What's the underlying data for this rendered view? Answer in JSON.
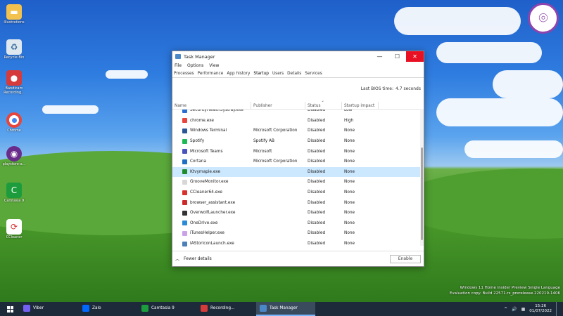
{
  "desktop": {
    "icons": [
      {
        "label": "Illustrations"
      },
      {
        "label": "Recycle Bin"
      },
      {
        "label": "Bandicam Recording..."
      },
      {
        "label": "Chrome"
      },
      {
        "label": "playstore-a..."
      },
      {
        "label": "Camtasia 9"
      },
      {
        "label": "CCleaner"
      }
    ],
    "watermark_line1": "Windows 11 Home Insider Preview Single Language",
    "watermark_line2": "Evaluation copy. Build 22571.rs_prerelease.220219-1406"
  },
  "taskmanager": {
    "title": "Task Manager",
    "controls": {
      "minimize": "—",
      "maximize": "☐",
      "close": "✕"
    },
    "menu": [
      "File",
      "Options",
      "View"
    ],
    "tabs": [
      "Processes",
      "Performance",
      "App history",
      "Startup",
      "Users",
      "Details",
      "Services"
    ],
    "active_tab": "Startup",
    "bios_label": "Last BIOS time:",
    "bios_value": "4.7 seconds",
    "columns": {
      "name": "Name",
      "publisher": "Publisher",
      "status": "Status",
      "impact": "Startup impact"
    },
    "rows": [
      {
        "name": "SecurityHealthSystray.exe",
        "publisher": "",
        "status": "Disabled",
        "impact": "Low",
        "icon_color": "#2a6fd0"
      },
      {
        "name": "chrome.exe",
        "publisher": "",
        "status": "Disabled",
        "impact": "High",
        "icon_color": "#e8453c"
      },
      {
        "name": "Windows Terminal",
        "publisher": "Microsoft Corporation",
        "status": "Disabled",
        "impact": "None",
        "icon_color": "#2b5797"
      },
      {
        "name": "Spotify",
        "publisher": "Spotify AB",
        "status": "Disabled",
        "impact": "None",
        "icon_color": "#1db954"
      },
      {
        "name": "Microsoft Teams",
        "publisher": "Microsoft",
        "status": "Disabled",
        "impact": "None",
        "icon_color": "#4b53bc"
      },
      {
        "name": "Cortana",
        "publisher": "Microsoft Corporation",
        "status": "Disabled",
        "impact": "None",
        "icon_color": "#1f6fc5"
      },
      {
        "name": "Ktvymapie.exe",
        "publisher": "",
        "status": "Disabled",
        "impact": "None",
        "icon_color": "#1d8c2e",
        "selected": true
      },
      {
        "name": "GrooveMonitor.exe",
        "publisher": "",
        "status": "Disabled",
        "impact": "None",
        "icon_color": "#d7d7d7"
      },
      {
        "name": "CCleaner64.exe",
        "publisher": "",
        "status": "Disabled",
        "impact": "None",
        "icon_color": "#d8322f"
      },
      {
        "name": "browser_assistant.exe",
        "publisher": "",
        "status": "Disabled",
        "impact": "None",
        "icon_color": "#cc2b2b"
      },
      {
        "name": "OverwolfLauncher.exe",
        "publisher": "",
        "status": "Disabled",
        "impact": "None",
        "icon_color": "#333333"
      },
      {
        "name": "OneDrive.exe",
        "publisher": "",
        "status": "Disabled",
        "impact": "None",
        "icon_color": "#2a8ad6"
      },
      {
        "name": "iTunesHelper.exe",
        "publisher": "",
        "status": "Disabled",
        "impact": "None",
        "icon_color": "#c9a2e8"
      },
      {
        "name": "IAStorIconLaunch.exe",
        "publisher": "",
        "status": "Disabled",
        "impact": "None",
        "icon_color": "#4d7fb8"
      }
    ],
    "fewer_details": "Fewer details",
    "enable_button": "Enable"
  },
  "taskbar": {
    "items": [
      {
        "label": "Viber",
        "color": "#7360f2"
      },
      {
        "label": "Zalo",
        "color": "#0068ff"
      },
      {
        "label": "Camtasia 9",
        "color": "#1c9c3c"
      },
      {
        "label": "Recording...",
        "color": "#d63b3b"
      },
      {
        "label": "Task Manager",
        "color": "#4a88c8",
        "active": true
      }
    ],
    "time": "15:26",
    "date": "01/07/2022"
  }
}
